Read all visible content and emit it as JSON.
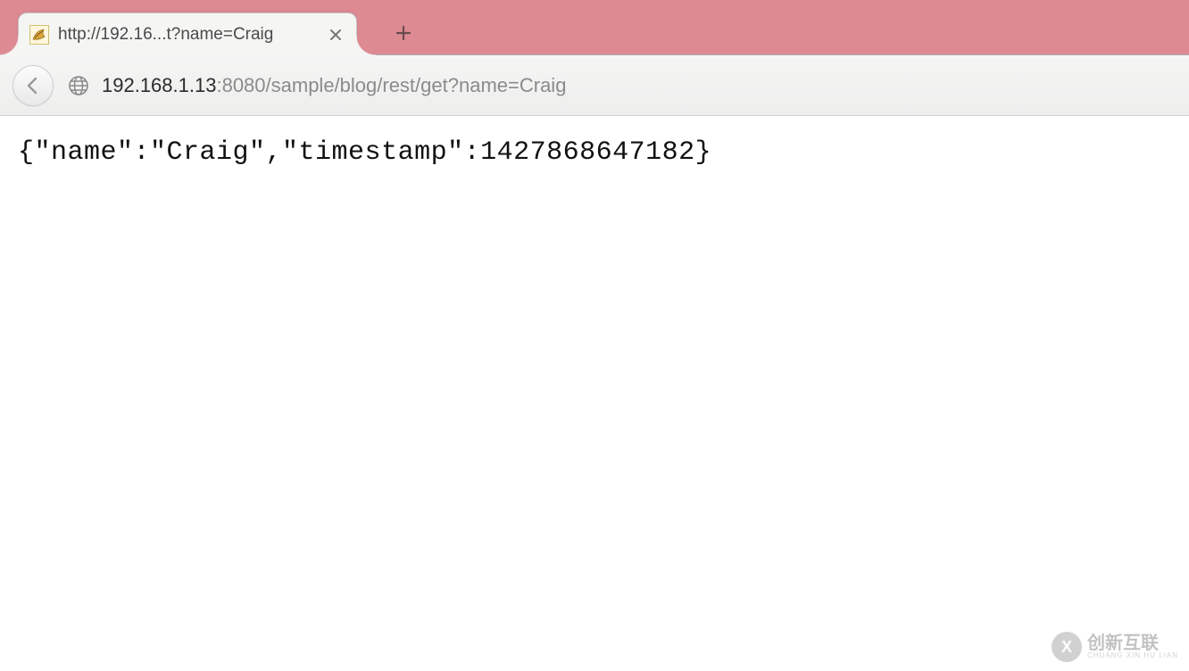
{
  "browser": {
    "tab": {
      "title": "http://192.16...t?name=Craig"
    },
    "address": {
      "host": "192.168.1.13",
      "path": ":8080/sample/blog/rest/get?name=Craig"
    }
  },
  "page": {
    "body_text": "{\"name\":\"Craig\",\"timestamp\":1427868647182}"
  },
  "watermark": {
    "logo_letter": "X",
    "main": "创新互联",
    "sub": "CHUANG XIN HU LIAN"
  }
}
